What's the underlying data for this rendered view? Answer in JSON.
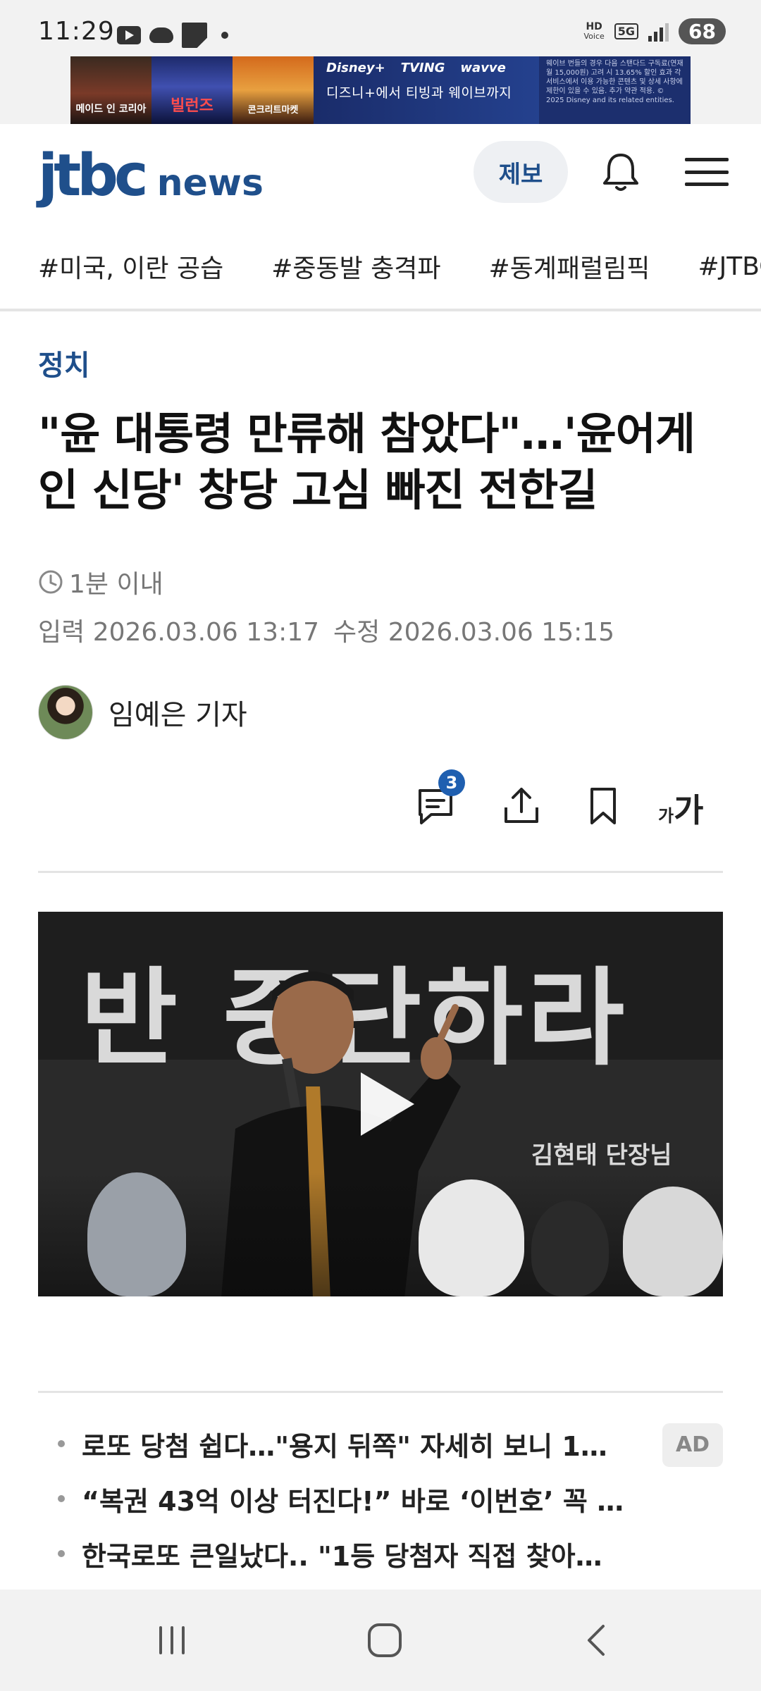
{
  "status_bar": {
    "time": "11:29",
    "hd_label": "HD",
    "voice_label": "Voice",
    "network": "5G",
    "battery": "68"
  },
  "ad_banner": {
    "poster1": "메이드 인 코리아",
    "poster2": "빌런즈",
    "poster3": "콘크리트마켓",
    "brands": [
      "Disney+",
      "TVING",
      "wavve"
    ],
    "copy": "디즈니+에서 티빙과 웨이브까지",
    "fine_print": "웨이브 번들의 경우 다음 스탠다드 구독료(연재 월 15,000원) 고려 시 13.65% 할인 효과 각 서비스에서 이용 가능한 콘텐츠 및 상세 사항에 제한이 있을 수 있음. 추가 약관 적용. © 2025 Disney and its related entities."
  },
  "header": {
    "logo_jtbc": "jtbc",
    "logo_news": "news",
    "report_button": "제보"
  },
  "hashtags": [
    "#미국, 이란 공습",
    "#중동발 충격파",
    "#동계패럴림픽",
    "#JTBC"
  ],
  "article": {
    "category": "정치",
    "title": "\"윤 대통령 만류해 참았다\"…'윤어게인 신당' 창당 고심 빠진 전한길",
    "read_time": "1분 이내",
    "input_label": "입력",
    "input_date": "2026.03.06 13:17",
    "edit_label": "수정",
    "edit_date": "2026.03.06 15:15",
    "reporter": "임예은 기자",
    "comment_count": "3",
    "font_size_small": "가",
    "font_size_large": "가"
  },
  "video": {
    "banner_text": "반 중단하라",
    "subtitle_text": "김현태 단장님"
  },
  "ads": {
    "label": "AD",
    "items": [
      "로또 당첨 쉽다…\"용지 뒤쪽\" 자세히 보니 1…",
      "“복권 43억 이상 터진다!” 바로 ‘이번호’ 꼭 …",
      "한국로또 큰일났다.. \"1등 당첨자 직접 찾아…"
    ]
  },
  "colors": {
    "brand": "#1f4f8b",
    "badge": "#1f5fb0",
    "muted_text": "#777777"
  }
}
